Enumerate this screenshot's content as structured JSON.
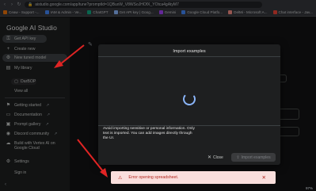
{
  "browser": {
    "url": "aistudio.google.com/app/tune?promptId=1QBuxW_V8WSoJHOfX_YOtca4gAtyM7",
    "bookmarks": [
      {
        "label": "Ceaw - Support -...",
        "color": "#e8710a"
      },
      {
        "label": "IAM & Admin - Ve...",
        "color": "#4285f4"
      },
      {
        "label": "ChatGPT",
        "color": "#10a37f"
      },
      {
        "label": "Get API key | Goog...",
        "color": "#8ab4f8"
      },
      {
        "label": "Gemini",
        "color": "#a142f4"
      },
      {
        "label": "Google Cloud Platfo...",
        "color": "#4285f4"
      },
      {
        "label": "DelMi - Microsoft A...",
        "color": "#f28b82"
      },
      {
        "label": "Chat interface - Jav...",
        "color": "#ea4335"
      }
    ]
  },
  "sidebar": {
    "brand": "Google AI Studio",
    "get_api_key": "Get API key",
    "create_new": "Create new",
    "new_tuned_model": "New tuned model",
    "my_library": "My library",
    "library_item": "DarBOP",
    "view_all": "View all",
    "getting_started": "Getting started",
    "documentation": "Documentation",
    "prompt_gallery": "Prompt gallery",
    "discord": "Discord community",
    "vertex": "Build with Vertex AI on Google Cloud",
    "settings": "Settings",
    "sign_in": "Sign in"
  },
  "modal": {
    "title": "Import examples",
    "note": "Avoid importing sensitive or personal information. Only text is imported. You can add images directly through the UI.",
    "close_label": "Close",
    "import_label": "Import examples"
  },
  "toast": {
    "message": "Error opening spreadsheet."
  },
  "status": {
    "zoom": "97%"
  },
  "colors": {
    "accent": "#8ab4f8",
    "error": "#b3261e",
    "annotation": "#e02424"
  }
}
